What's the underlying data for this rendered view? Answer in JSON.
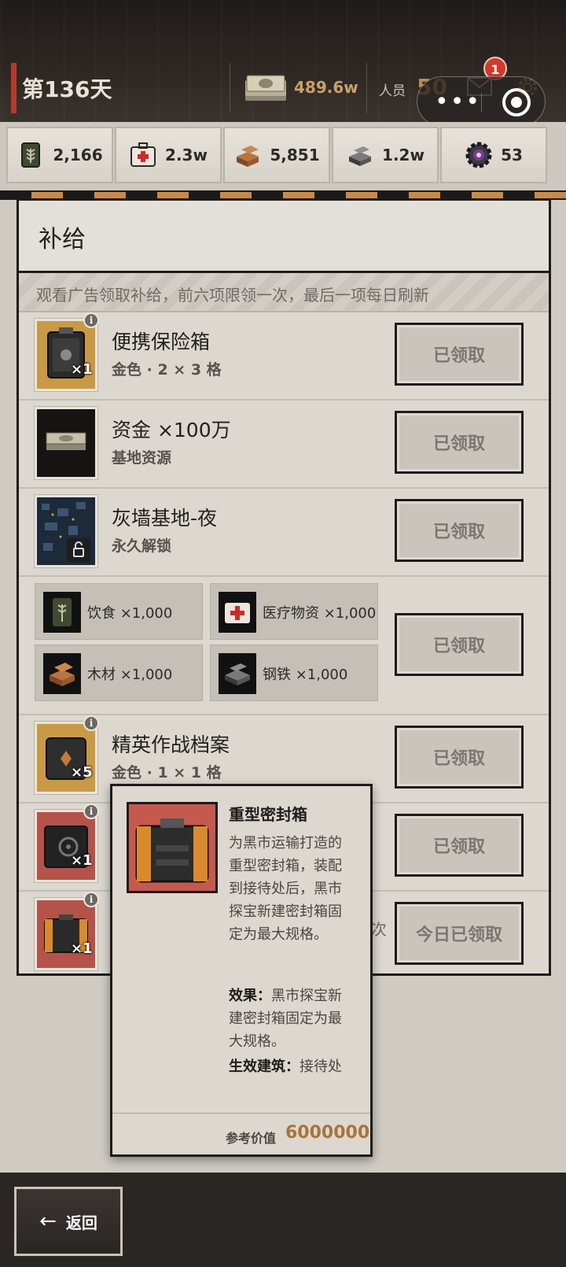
{
  "header": {
    "day": "第136天",
    "cash": "489.6w",
    "staff_label": "人员",
    "staff_value": "50",
    "notification_count": "1"
  },
  "resources": [
    {
      "name": "food",
      "icon": "food-can-icon",
      "value": "2,166"
    },
    {
      "name": "medical",
      "icon": "medkit-icon",
      "value": "2.3w"
    },
    {
      "name": "wood",
      "icon": "wood-icon",
      "value": "5,851"
    },
    {
      "name": "steel",
      "icon": "steel-icon",
      "value": "1.2w"
    },
    {
      "name": "parts",
      "icon": "gear-chip-icon",
      "value": "53"
    }
  ],
  "panel": {
    "title": "补给",
    "notice": "观看广告领取补给，前六项限领一次，最后一项每日刷新",
    "items": [
      {
        "name": "便携保险箱",
        "sub": "金色 · 2 × 3 格",
        "qty": "×1",
        "button": "已领取"
      },
      {
        "name": "资金 ×100万",
        "sub": "基地资源",
        "button": "已领取"
      },
      {
        "name": "灰墙基地-夜",
        "sub": "永久解锁",
        "button": "已领取"
      },
      {
        "bundle": [
          "饮食 ×1,000",
          "医疗物资 ×1,000",
          "木材 ×1,000",
          "钢铁 ×1,000"
        ],
        "button": "已领取"
      },
      {
        "name": "精英作战档案",
        "sub": "金色 · 1 × 1 格",
        "qty": "×5",
        "button": "已领取"
      },
      {
        "qty": "×1",
        "button": "已领取"
      },
      {
        "qty": "×1",
        "partial": "次",
        "button": "今日已领取"
      }
    ]
  },
  "tooltip": {
    "title": "重型密封箱",
    "desc": "为黑市运输打造的重型密封箱，装配到接待处后，黑市探宝新建密封箱固定为最大规格。",
    "effect_label": "效果：",
    "effect_text": "黑市探宝新建密封箱固定为最大规格。",
    "building_label": "生效建筑：",
    "building_text": "接待处",
    "ref_label": "参考价值",
    "ref_value": "6000000"
  },
  "footer": {
    "back_label": "返回"
  },
  "colors": {
    "accent_red": "#b53a2e",
    "gold": "#c8a26a",
    "ref_value": "#a8733c"
  }
}
